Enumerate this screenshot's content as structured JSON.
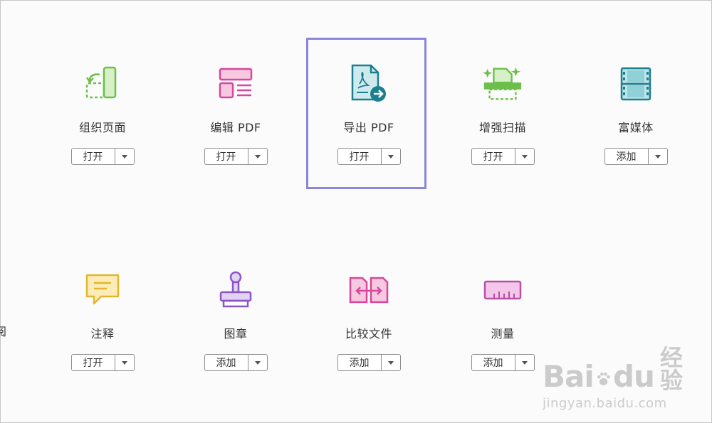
{
  "tools_row1": [
    {
      "label": "组织页面",
      "button": "打开",
      "icon": "organize-pages-icon"
    },
    {
      "label": "编辑 PDF",
      "button": "打开",
      "icon": "edit-pdf-icon"
    },
    {
      "label": "导出 PDF",
      "button": "打开",
      "icon": "export-pdf-icon"
    },
    {
      "label": "增强扫描",
      "button": "打开",
      "icon": "enhance-scan-icon"
    },
    {
      "label": "富媒体",
      "button": "添加",
      "icon": "rich-media-icon"
    }
  ],
  "tools_row2": [
    {
      "label": "注释",
      "button": "打开",
      "icon": "comment-icon"
    },
    {
      "label": "图章",
      "button": "添加",
      "icon": "stamp-icon"
    },
    {
      "label": "比较文件",
      "button": "添加",
      "icon": "compare-files-icon"
    },
    {
      "label": "测量",
      "button": "添加",
      "icon": "measure-icon"
    }
  ],
  "edge_text": "阅",
  "watermark": {
    "logo_a": "Bai",
    "logo_b": "du",
    "logo_cn": "经验",
    "url": "jingyan.baidu.com"
  },
  "colors": {
    "selection": "#8c86da",
    "green": "#6cbf4b",
    "pink": "#d9479b",
    "teal": "#1a7f8e",
    "yellow": "#e2b72e",
    "purple": "#8a56c8"
  }
}
